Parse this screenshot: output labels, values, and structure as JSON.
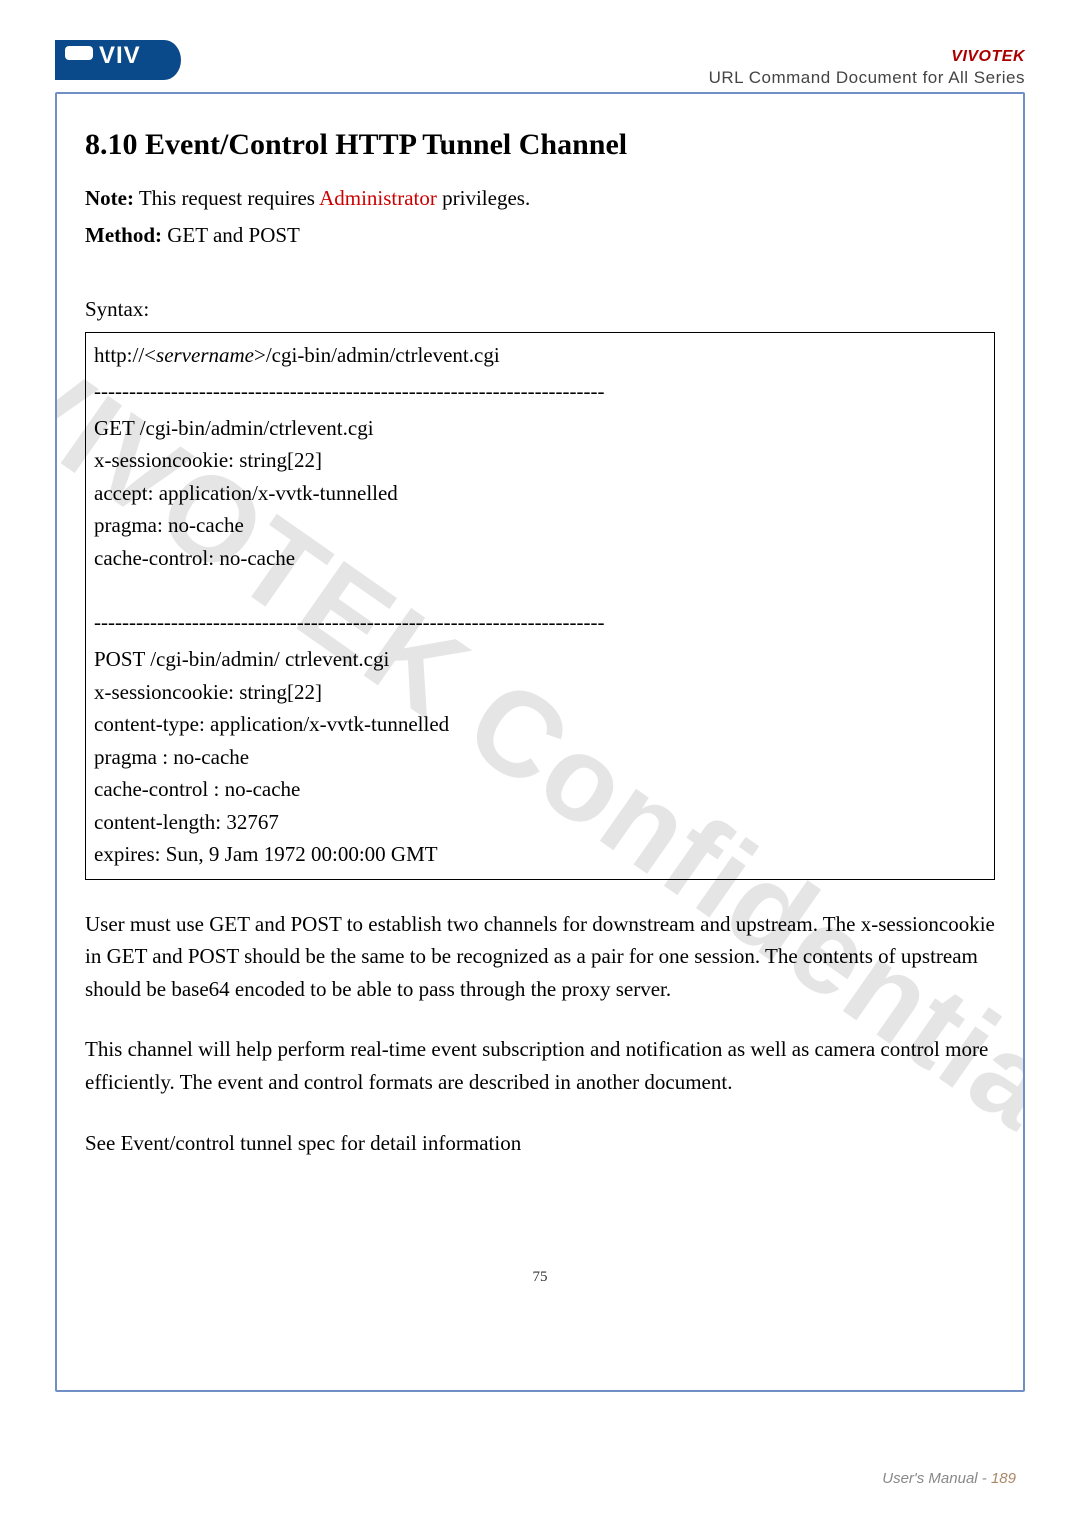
{
  "header": {
    "brand": "VIVOTEK",
    "doc_title": "URL Command Document for All Series",
    "logo_text": "VIV",
    "logo_sub": ""
  },
  "section": {
    "number_title": "8.10 Event/Control HTTP Tunnel Channel",
    "note_label": "Note:",
    "note_text_pre": " This request requires ",
    "note_priv": "Administrator",
    "note_text_post": " privileges.",
    "method_label": "Method:",
    "method_value": " GET and POST",
    "syntax_label": "Syntax:"
  },
  "syntax": {
    "url_prefix": "http://<",
    "url_server": "servername",
    "url_suffix": ">/cgi-bin/admin/ctrlevent.cgi",
    "dash1": "-------------------------------------------------------------------------",
    "get": [
      "GET /cgi-bin/admin/ctrlevent.cgi",
      "x-sessioncookie: string[22]",
      "accept: application/x-vvtk-tunnelled",
      "pragma: no-cache",
      "cache-control: no-cache"
    ],
    "dash2": "-------------------------------------------------------------------------",
    "post": [
      "POST /cgi-bin/admin/ ctrlevent.cgi",
      "x-sessioncookie: string[22]",
      "content-type: application/x-vvtk-tunnelled",
      "pragma : no-cache",
      "cache-control : no-cache",
      "content-length: 32767",
      "expires: Sun, 9 Jam 1972 00:00:00 GMT"
    ]
  },
  "paragraphs": {
    "p1": "User must use GET and POST to establish two channels for downstream and upstream. The x-sessioncookie in GET and POST should be the same to be recognized as a pair for one session. The contents of upstream should be base64 encoded to be able to pass through the proxy server.",
    "p2": "This channel will help perform real-time event subscription and notification as well as camera control more efficiently. The event and control formats are described in another document.",
    "p3": "See Event/control tunnel spec for detail information"
  },
  "inner_page": "75",
  "footer": {
    "label": "User's Manual - ",
    "page": "189"
  },
  "watermark": "VIVOTEK Confidential"
}
